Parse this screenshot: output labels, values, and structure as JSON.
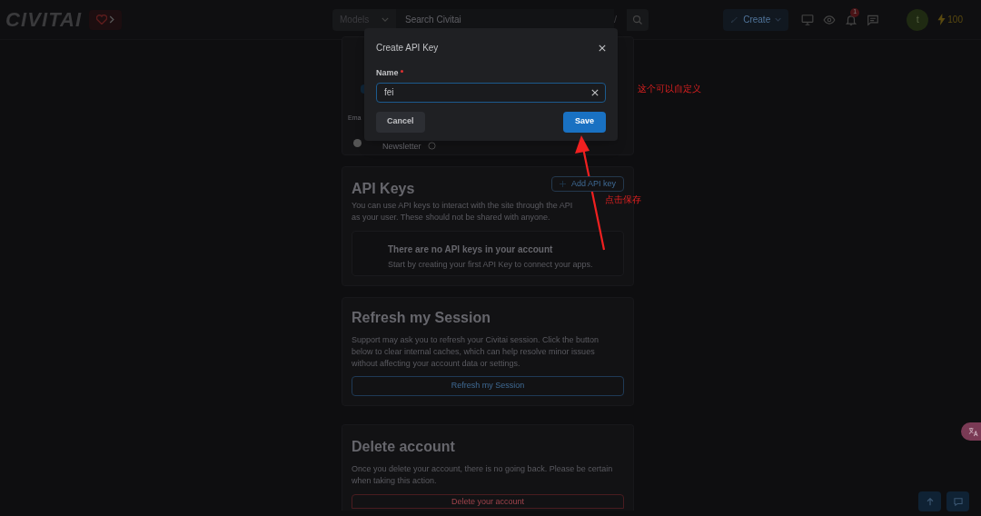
{
  "header": {
    "logo": "CIVITAI",
    "search": {
      "model_filter": "Models",
      "placeholder": "Search Civitai",
      "shortcut": "/"
    },
    "create_button": "Create",
    "notification_count": "1",
    "avatar_initial": "t",
    "buzz": "100"
  },
  "settings_card": {
    "partial_label": "Ema",
    "newsletter": "Newsletter"
  },
  "api_keys": {
    "title": "API Keys",
    "add_button": "Add API key",
    "description": "You can use API keys to interact with the site through the API as your user. These should not be shared with anyone.",
    "empty_title": "There are no API keys in your account",
    "empty_text": "Start by creating your first API Key to connect your apps."
  },
  "refresh_session": {
    "title": "Refresh my Session",
    "description": "Support may ask you to refresh your Civitai session. Click the button below to clear internal caches, which can help resolve minor issues without affecting your account data or settings.",
    "button": "Refresh my Session"
  },
  "delete_account": {
    "title": "Delete account",
    "description": "Once you delete your account, there is no going back. Please be certain when taking this action.",
    "button": "Delete your account"
  },
  "dialog": {
    "title": "Create API Key",
    "field_label": "Name",
    "required": true,
    "value": "fei",
    "buttons": [
      {
        "label": "Cancel",
        "kind": "secondary"
      },
      {
        "label": "Save",
        "kind": "primary"
      }
    ]
  },
  "annotations": [
    {
      "text": "这个可以自定义"
    },
    {
      "text": "点击保存"
    }
  ]
}
